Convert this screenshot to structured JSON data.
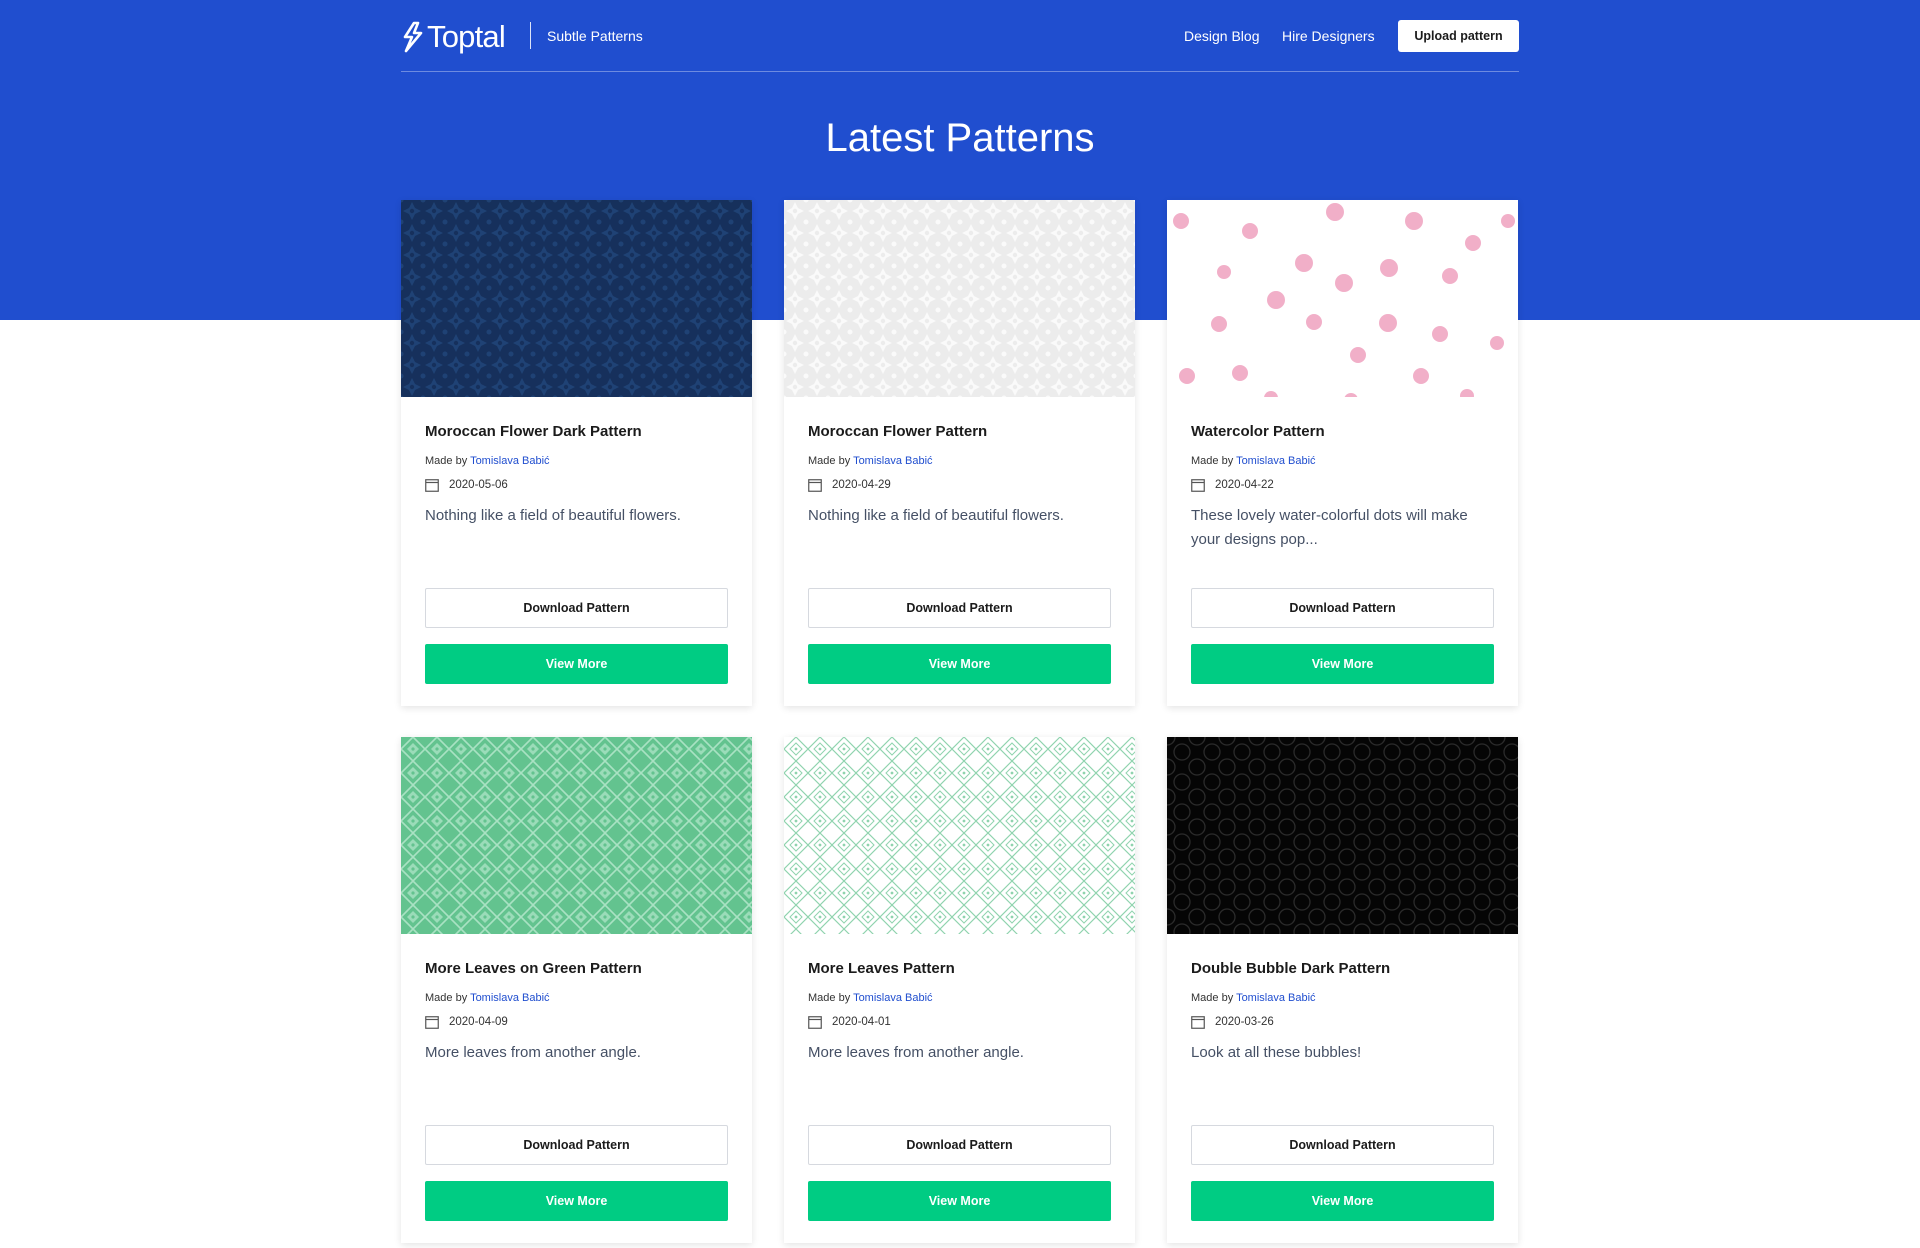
{
  "header": {
    "brand": "Toptal",
    "product": "Subtle Patterns",
    "nav": [
      {
        "label": "Design Blog"
      },
      {
        "label": "Hire Designers"
      }
    ],
    "upload_label": "Upload pattern"
  },
  "page": {
    "title": "Latest Patterns"
  },
  "colors": {
    "brand_blue": "#204ecf",
    "view_green": "#00cc83",
    "link_blue": "#204ecf"
  },
  "cards": [
    {
      "title": "Moroccan Flower Dark Pattern",
      "made_by_label": "Made by",
      "author": "Tomislava Babić",
      "date": "2020-05-06",
      "description": "Nothing like a field of beautiful flowers.",
      "download_label": "Download Pattern",
      "view_label": "View More"
    },
    {
      "title": "Moroccan Flower Pattern",
      "made_by_label": "Made by",
      "author": "Tomislava Babić",
      "date": "2020-04-29",
      "description": "Nothing like a field of beautiful flowers.",
      "download_label": "Download Pattern",
      "view_label": "View More"
    },
    {
      "title": "Watercolor Pattern",
      "made_by_label": "Made by",
      "author": "Tomislava Babić",
      "date": "2020-04-22",
      "description": "These lovely water-colorful dots will make your designs pop...",
      "download_label": "Download Pattern",
      "view_label": "View More"
    },
    {
      "title": "More Leaves on Green Pattern",
      "made_by_label": "Made by",
      "author": "Tomislava Babić",
      "date": "2020-04-09",
      "description": "More leaves from another angle.",
      "download_label": "Download Pattern",
      "view_label": "View More"
    },
    {
      "title": "More Leaves Pattern",
      "made_by_label": "Made by",
      "author": "Tomislava Babić",
      "date": "2020-04-01",
      "description": "More leaves from another angle.",
      "download_label": "Download Pattern",
      "view_label": "View More"
    },
    {
      "title": "Double Bubble Dark Pattern",
      "made_by_label": "Made by",
      "author": "Tomislava Babić",
      "date": "2020-03-26",
      "description": "Look at all these bubbles!",
      "download_label": "Download Pattern",
      "view_label": "View More"
    }
  ]
}
